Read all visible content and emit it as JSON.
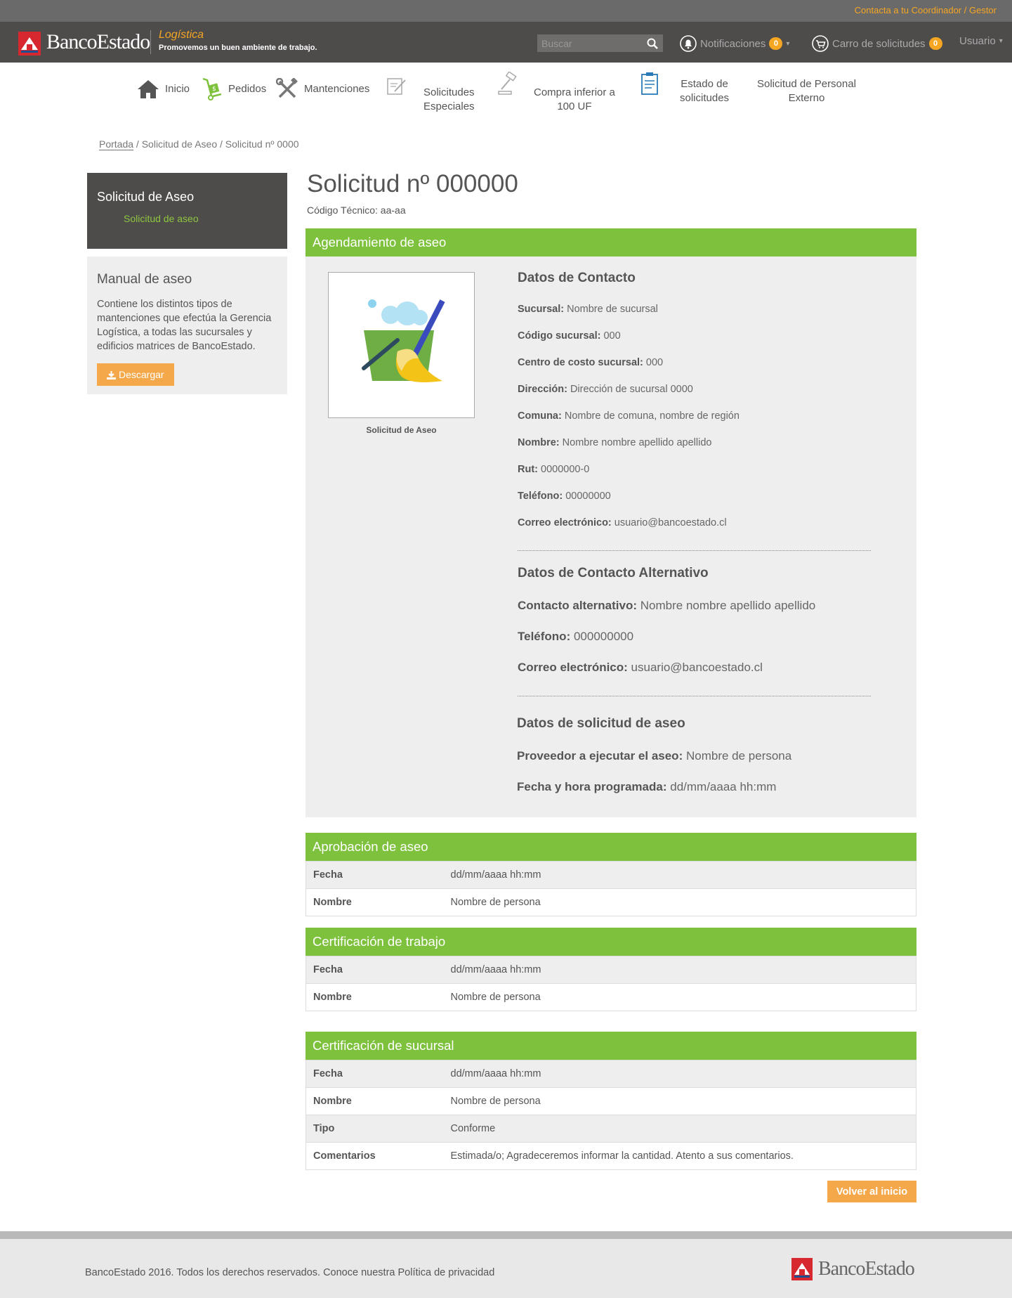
{
  "topbar": {
    "contact_link": "Contacta a tu Coordinador / Gestor"
  },
  "header": {
    "logo_text": "BancoEstado",
    "app_name": "Logística",
    "tagline": "Promovemos un buen ambiente de trabajo.",
    "search_placeholder": "Buscar",
    "notifications_label": "Notificaciones",
    "notifications_count": "0",
    "cart_label": "Carro de solicitudes",
    "cart_count": "0",
    "user_label": "Usuario"
  },
  "nav": {
    "items": [
      {
        "label": "Inicio",
        "icon": "home-icon"
      },
      {
        "label": "Pedidos",
        "icon": "hand-truck-icon"
      },
      {
        "label": "Mantenciones",
        "icon": "tools-icon"
      },
      {
        "label_line1": "Solicitudes",
        "label_line2": "Especiales",
        "icon": "edit-document-icon"
      },
      {
        "label_line1": "Compra inferior a",
        "label_line2": "100 UF",
        "icon": "gavel-icon"
      },
      {
        "label_line1": "Estado de",
        "label_line2": "solicitudes",
        "icon": "clipboard-icon"
      },
      {
        "label_line1": "Solicitud de Personal",
        "label_line2": "Externo"
      }
    ]
  },
  "breadcrumb": {
    "home": "Portada",
    "rest": " / Solicitud de Aseo / Solicitud nº 0000"
  },
  "sidebar": {
    "section_title": "Solicitud de Aseo",
    "section_link": "Solicitud de aseo",
    "manual_title": "Manual de aseo",
    "manual_desc": "Contiene los distintos tipos de mantenciones que efectúa la Gerencia Logística, a todas las sucursales y edificios matrices de BancoEstado.",
    "download_label": "Descargar"
  },
  "main": {
    "title": "Solicitud nº 000000",
    "code_line": "Código Técnico: aa-aa"
  },
  "agenda": {
    "header": "Agendamiento de aseo",
    "image_caption": "Solicitud de Aseo",
    "contact_title": "Datos de Contacto",
    "contact_fields": [
      {
        "k": "Sucursal:",
        "v": "Nombre de sucursal"
      },
      {
        "k": "Código sucursal:",
        "v": "000"
      },
      {
        "k": "Centro de costo sucursal:",
        "v": "000"
      },
      {
        "k": "Dirección:",
        "v": "Dirección de sucursal 0000"
      },
      {
        "k": "Comuna:",
        "v": "Nombre de comuna, nombre de región"
      },
      {
        "k": "Nombre:",
        "v": "Nombre nombre apellido apellido"
      },
      {
        "k": "Rut:",
        "v": "0000000-0"
      },
      {
        "k": "Teléfono:",
        "v": "00000000"
      },
      {
        "k": "Correo electrónico:",
        "v": "usuario@bancoestado.cl"
      }
    ],
    "alt_title": "Datos de Contacto Alternativo",
    "alt_fields": [
      {
        "k": "Contacto alternativo:",
        "v": "Nombre nombre apellido apellido"
      },
      {
        "k": "Teléfono:",
        "v": "000000000"
      },
      {
        "k": "Correo electrónico:",
        "v": "usuario@bancoestado.cl"
      }
    ],
    "request_title": "Datos de solicitud de aseo",
    "request_fields": [
      {
        "k": "Proveedor a ejecutar el aseo:",
        "v": "Nombre de persona"
      },
      {
        "k": "Fecha y hora programada:",
        "v": "dd/mm/aaaa hh:mm"
      }
    ]
  },
  "aprobacion": {
    "header": "Aprobación de aseo",
    "rows": [
      {
        "k": "Fecha",
        "v": "dd/mm/aaaa hh:mm"
      },
      {
        "k": "Nombre",
        "v": "Nombre de persona"
      }
    ]
  },
  "cert_trabajo": {
    "header": "Certificación de trabajo",
    "rows": [
      {
        "k": "Fecha",
        "v": "dd/mm/aaaa hh:mm"
      },
      {
        "k": "Nombre",
        "v": "Nombre de persona"
      }
    ]
  },
  "cert_sucursal": {
    "header": "Certificación de sucursal",
    "rows": [
      {
        "k": "Fecha",
        "v": "dd/mm/aaaa hh:mm"
      },
      {
        "k": "Nombre",
        "v": "Nombre de persona"
      },
      {
        "k": "Tipo",
        "v": "Conforme"
      },
      {
        "k": "Comentarios",
        "v": "Estimada/o;  Agradeceremos informar la cantidad. Atento a sus comentarios."
      }
    ]
  },
  "actions": {
    "back_label": "Volver al inicio"
  },
  "footer": {
    "copyright": "BancoEstado 2016. Todos los derechos reservados. Conoce nuestra Política de privacidad",
    "logo_text": "BancoEstado"
  },
  "colors": {
    "accent_green": "#7dc13c",
    "accent_orange": "#f5a623",
    "header_dark": "#4e4b4b"
  }
}
